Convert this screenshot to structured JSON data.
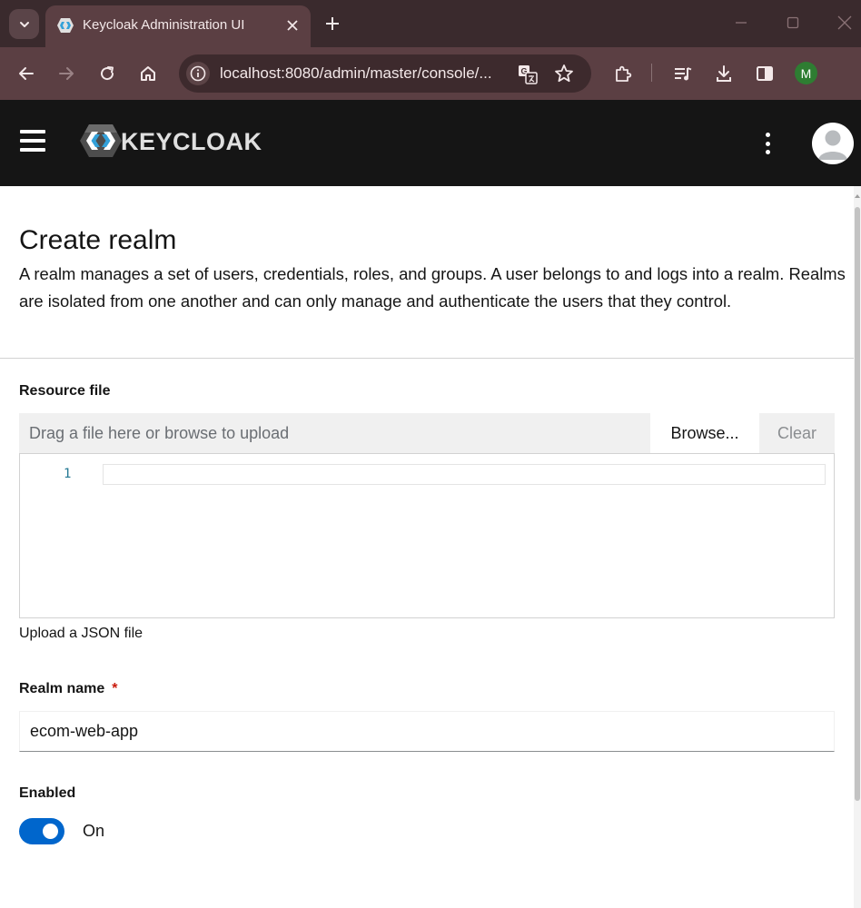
{
  "browser": {
    "tab_title": "Keycloak Administration UI",
    "url": "localhost:8080/admin/master/console/...",
    "profile_initial": "M",
    "icons": [
      "tab-search-icon",
      "keycloak-favicon-icon",
      "close-icon",
      "plus-icon",
      "minimize-icon",
      "maximize-icon",
      "close-window-icon",
      "back-arrow-icon",
      "forward-arrow-icon",
      "reload-icon",
      "home-icon",
      "info-icon",
      "translate-icon",
      "star-icon",
      "extensions-icon",
      "media-queue-icon",
      "download-icon",
      "side-panel-icon"
    ]
  },
  "header": {
    "brand": "KEYCLOAK",
    "icons": [
      "hamburger-icon",
      "keycloak-logo-icon",
      "kebab-menu-icon",
      "user-avatar-icon"
    ]
  },
  "page": {
    "title": "Create realm",
    "description": "A realm manages a set of users, credentials, roles, and groups. A user belongs to and logs into a realm. Realms are isolated from one another and can only manage and authenticate the users that they control."
  },
  "resource_file": {
    "label": "Resource file",
    "placeholder": "Drag a file here or browse to upload",
    "browse_label": "Browse...",
    "clear_label": "Clear",
    "line_number": "1",
    "helper_text": "Upload a JSON file"
  },
  "realm_name": {
    "label": "Realm name",
    "required_mark": "*",
    "value": "ecom-web-app"
  },
  "enabled": {
    "label": "Enabled",
    "state_text": "On",
    "checked": true
  },
  "colors": {
    "chrome_frame": "#3a2a2d",
    "chrome_toolbar": "#5b3f43",
    "header_bg": "#151515",
    "accent_blue": "#0066cc",
    "required_red": "#c9190b"
  }
}
